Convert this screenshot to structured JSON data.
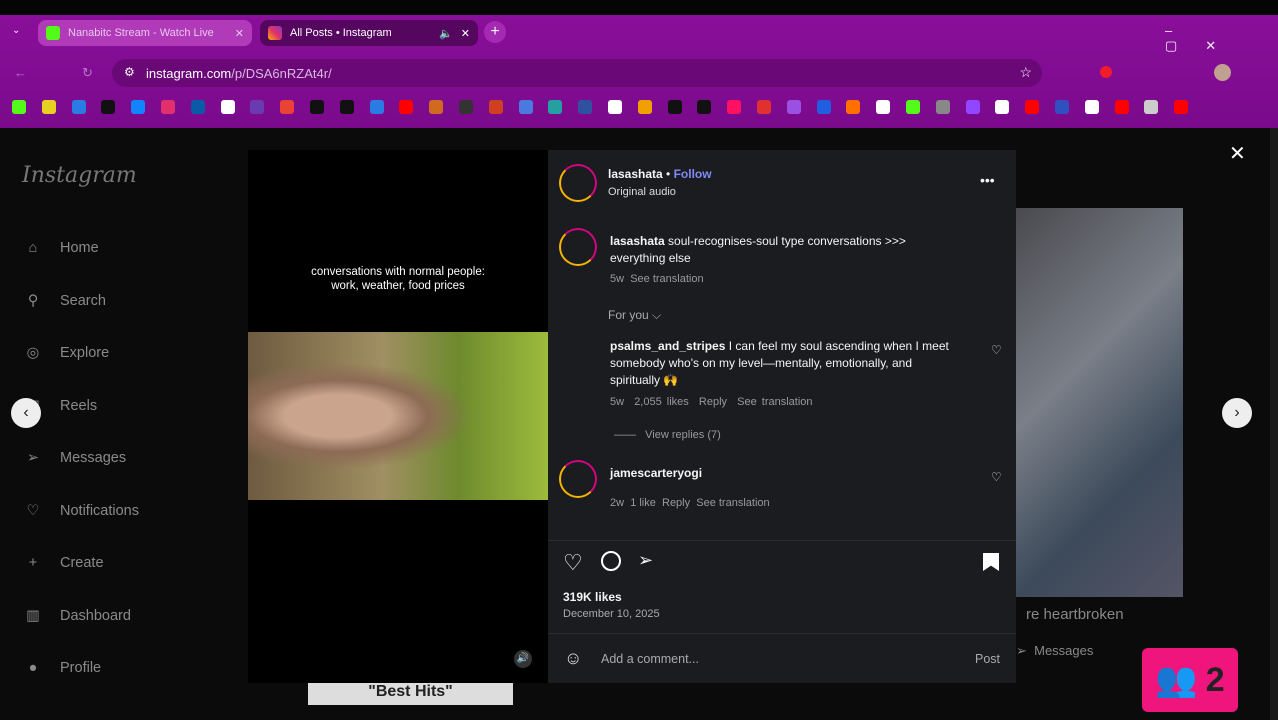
{
  "browser": {
    "tabs": [
      {
        "title": "Nanabitc Stream - Watch Live",
        "favicon": "kick-icon",
        "color": "#53fc18",
        "active": false
      },
      {
        "title": "All Posts • Instagram",
        "favicon": "instagram-icon",
        "color": "#e1306c",
        "active": true
      }
    ],
    "url_host": "instagram.com",
    "url_path": "/p/DSA6nRZAt4r/",
    "bookmarks": [
      "#53fc18",
      "#e8d020",
      "#2a7be4",
      "#111111",
      "#1185fe",
      "#e1306c",
      "#0a5aa8",
      "#ffffff",
      "#6a3ab0",
      "#ea4335",
      "#111111",
      "#111111",
      "#2a7be4",
      "#ff0000",
      "#d06a20",
      "#333333",
      "#d04020",
      "#4a7ae0",
      "#24a0a0",
      "#3050a0",
      "#ffffff",
      "#f0a000",
      "#111111",
      "#111111",
      "#ff1060",
      "#e03030",
      "#9a50e0",
      "#2060e0",
      "#ff7000",
      "#ffffff",
      "#53fc18",
      "#888888",
      "#9146ff",
      "#ffffff",
      "#ff0000",
      "#3050c0",
      "#ffffff",
      "#ff0000",
      "#cccccc",
      "#ff0000"
    ]
  },
  "sidebar": {
    "logo": "Instagram",
    "items": [
      {
        "label": "Home",
        "icon": "home-icon"
      },
      {
        "label": "Search",
        "icon": "search-icon"
      },
      {
        "label": "Explore",
        "icon": "compass-icon"
      },
      {
        "label": "Reels",
        "icon": "reels-icon"
      },
      {
        "label": "Messages",
        "icon": "send-icon"
      },
      {
        "label": "Notifications",
        "icon": "heart-icon"
      },
      {
        "label": "Create",
        "icon": "plus-icon"
      },
      {
        "label": "Dashboard",
        "icon": "chart-icon"
      },
      {
        "label": "Profile",
        "icon": "avatar-icon"
      }
    ]
  },
  "video": {
    "overlay_text_1": "conversations with normal people:",
    "overlay_text_2": "work, weather, food prices"
  },
  "post": {
    "username": "lasashata",
    "follow": "Follow",
    "audio": "Original audio",
    "caption_user": "lasashata",
    "caption": "soul-recognises-soul type conversations >>> everything else",
    "caption_age": "5w",
    "see_translation": "See translation",
    "sort": "For you",
    "comments": [
      {
        "user": "psalms_and_stripes",
        "text": "I can feel my soul ascending when I meet somebody who's on my level—mentally, emotionally, and spiritually 🙌",
        "age": "5w",
        "likes": "2,055 likes",
        "reply": "Reply",
        "translate": "See translation",
        "view_replies": "View replies (7)"
      },
      {
        "user": "jamescarteryogi",
        "text": "",
        "age": "2w",
        "likes": "1 like",
        "reply": "Reply",
        "translate": "See translation"
      }
    ],
    "likes": "319K likes",
    "date": "December 10, 2025",
    "comment_placeholder": "Add a comment...",
    "post_button": "Post"
  },
  "preview": {
    "caption": "re heartbroken",
    "messages": "Messages"
  },
  "bottom_preview": "\"Best Hits\"",
  "badge": {
    "count": "2"
  }
}
